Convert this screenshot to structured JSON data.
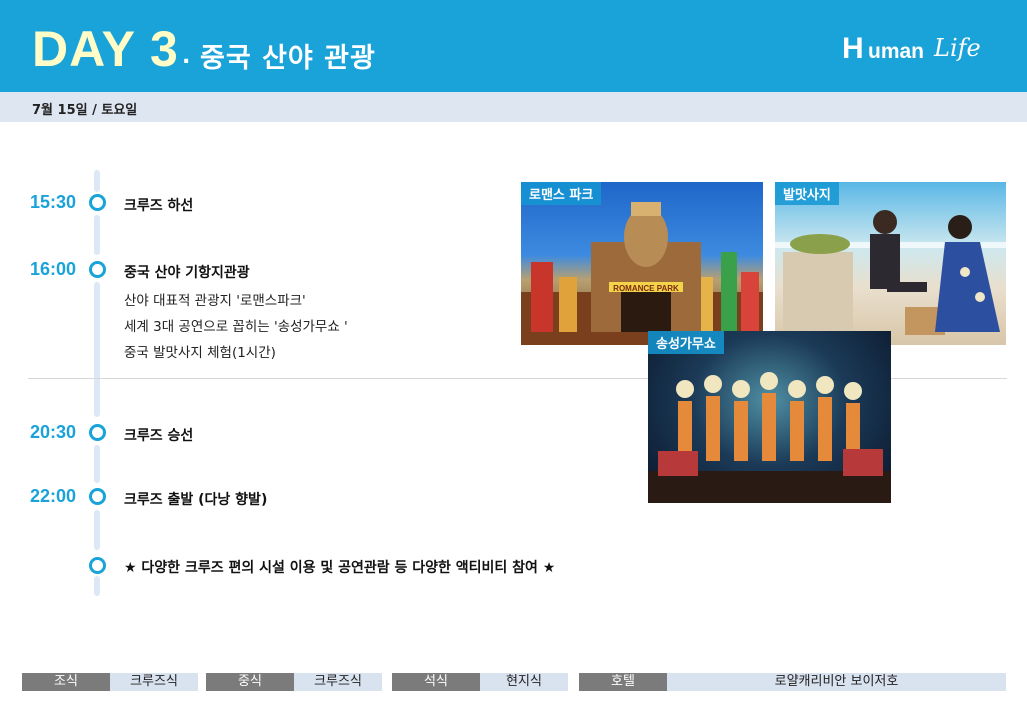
{
  "header": {
    "day_word": "DAY",
    "day_number": "3",
    "separator": ".",
    "title": "중국 산야 관광",
    "logo_h": "H",
    "logo_uman": "uman",
    "logo_life": "Life",
    "accent_color": "#1aa3d9",
    "day_color": "#fffcc8"
  },
  "date": "7월 15일 / 토요일",
  "schedule": [
    {
      "time": "15:30",
      "title": "크루즈 하선",
      "details": []
    },
    {
      "time": "16:00",
      "title": "중국 산야 기항지관광",
      "details": [
        "산야 대표적 관광지 '로맨스파크'",
        "세계 3대 공연으로 꼽히는 '송성가무쇼 '",
        "중국 발맛사지 체험(1시간)"
      ]
    },
    {
      "time": "20:30",
      "title": "크루즈 승선",
      "details": []
    },
    {
      "time": "22:00",
      "title": "크루즈 출발 (다낭 향발)",
      "details": []
    },
    {
      "time": "",
      "title": "★ 다양한 크루즈 편의 시설 이용 및 공연관람 등 다양한 액티비티 참여 ★",
      "details": []
    }
  ],
  "photos": {
    "romance_park": "로맨스 파크",
    "foot_massage": "발맛사지",
    "songcheng_show": "송성가무쇼",
    "romance_sign": "ROMANCE PARK"
  },
  "footer": {
    "breakfast_label": "조식",
    "breakfast_value": "크루즈식",
    "lunch_label": "중식",
    "lunch_value": "크루즈식",
    "dinner_label": "석식",
    "dinner_value": "현지식",
    "hotel_label": "호텔",
    "hotel_value": "로얄캐리비안 보이저호"
  }
}
